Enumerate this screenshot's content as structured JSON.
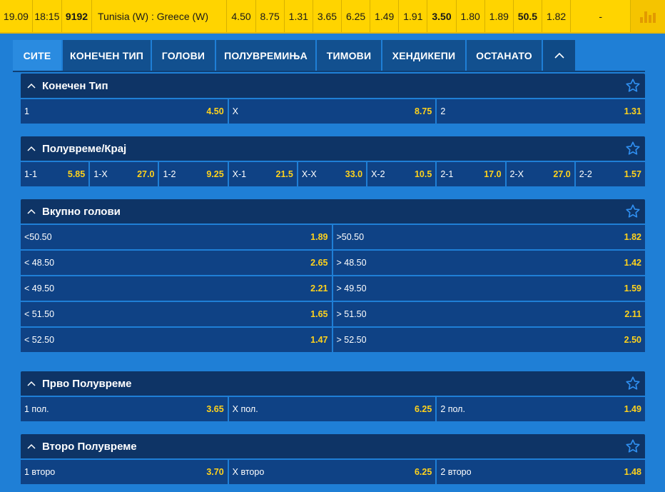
{
  "event": {
    "date": "19.09",
    "time": "18:15",
    "code": "9192",
    "match": "Tunisia (W) : Greece (W)",
    "odds": [
      "4.50",
      "8.75",
      "1.31",
      "3.65",
      "6.25",
      "1.49",
      "1.91",
      "3.50",
      "1.80",
      "1.89",
      "50.5",
      "1.82",
      "-"
    ],
    "chart_icon": "bar-chart-icon"
  },
  "tabs": [
    "СИТЕ",
    "КОНЕЧЕН ТИП",
    "ГОЛОВИ",
    "ПОЛУВРЕМИЊА",
    "ТИМОВИ",
    "ХЕНДИКЕПИ",
    "ОСТАНАТО"
  ],
  "colors": {
    "background": "#1f7fd6",
    "header": "#0e3466",
    "cell": "#0f4285",
    "odd": "#ffd21c",
    "top_row": "#ffd400"
  },
  "sections": {
    "final": {
      "title": "Конечен Тип",
      "rows": [
        [
          {
            "label": "1",
            "odd": "4.50"
          },
          {
            "label": "X",
            "odd": "8.75"
          },
          {
            "label": "2",
            "odd": "1.31"
          }
        ]
      ]
    },
    "halffull": {
      "title": "Полувреме/Крај",
      "rows": [
        [
          {
            "label": "1-1",
            "odd": "5.85"
          },
          {
            "label": "1-X",
            "odd": "27.0"
          },
          {
            "label": "1-2",
            "odd": "9.25"
          },
          {
            "label": "X-1",
            "odd": "21.5"
          },
          {
            "label": "X-X",
            "odd": "33.0"
          },
          {
            "label": "X-2",
            "odd": "10.5"
          },
          {
            "label": "2-1",
            "odd": "17.0"
          },
          {
            "label": "2-X",
            "odd": "27.0"
          },
          {
            "label": "2-2",
            "odd": "1.57"
          }
        ]
      ]
    },
    "totals": {
      "title": "Вкупно голови",
      "rows": [
        [
          {
            "label": "<50.50",
            "odd": "1.89"
          },
          {
            "label": ">50.50",
            "odd": "1.82"
          }
        ],
        [
          {
            "label": "< 48.50",
            "odd": "2.65"
          },
          {
            "label": "> 48.50",
            "odd": "1.42"
          }
        ],
        [
          {
            "label": "< 49.50",
            "odd": "2.21"
          },
          {
            "label": "> 49.50",
            "odd": "1.59"
          }
        ],
        [
          {
            "label": "< 51.50",
            "odd": "1.65"
          },
          {
            "label": "> 51.50",
            "odd": "2.11"
          }
        ],
        [
          {
            "label": "< 52.50",
            "odd": "1.47"
          },
          {
            "label": "> 52.50",
            "odd": "2.50"
          }
        ]
      ]
    },
    "firsthalf": {
      "title": "Прво Полувреме",
      "rows": [
        [
          {
            "label": "1 пол.",
            "odd": "3.65"
          },
          {
            "label": "X пол.",
            "odd": "6.25"
          },
          {
            "label": "2 пол.",
            "odd": "1.49"
          }
        ]
      ]
    },
    "secondhalf": {
      "title": "Второ Полувреме",
      "rows": [
        [
          {
            "label": "1 второ",
            "odd": "3.70"
          },
          {
            "label": "X второ",
            "odd": "6.25"
          },
          {
            "label": "2 второ",
            "odd": "1.48"
          }
        ]
      ]
    }
  }
}
